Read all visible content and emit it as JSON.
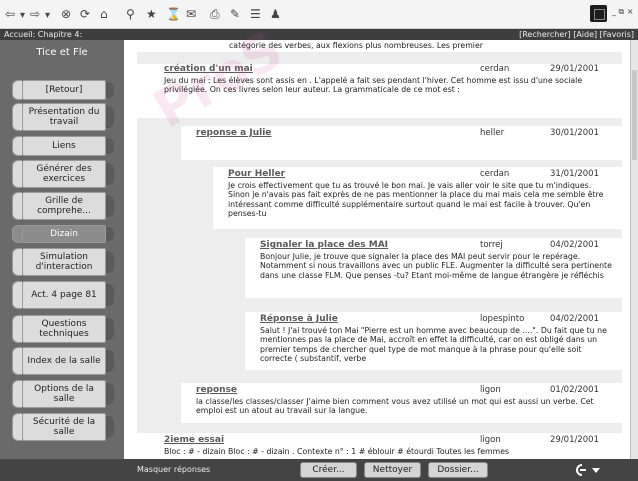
{
  "toolbar": {
    "back": "⇦",
    "forward": "⇨",
    "stop": "⊗",
    "refresh": "⟳",
    "home": "⌂",
    "search": "⚲",
    "favorites": "★",
    "history": "⌛",
    "mail": "✉",
    "print": "⎙",
    "edit": "✎",
    "discuss": "☰",
    "messenger": "♟",
    "window_controls": "_ ⧉ ×"
  },
  "header": {
    "breadcrumb": "Accueil: Chapitre 4:",
    "links": "[Rechercher] [Aide] [Favoris]"
  },
  "sidebar": {
    "title": "Tice et Fle",
    "items": [
      {
        "label": "[Retour]"
      },
      {
        "label": "Présentation du travail"
      },
      {
        "label": "Liens"
      },
      {
        "label": "Générer des exercices"
      },
      {
        "label": "Grille de comprehe..."
      },
      {
        "label": "Dizain"
      },
      {
        "label": "Simulation d'interaction"
      },
      {
        "label": "Act. 4 page 81"
      },
      {
        "label": "Questions techniques"
      },
      {
        "label": "Index de la salle"
      },
      {
        "label": "Options de la salle"
      },
      {
        "label": "Sécurité de la salle"
      }
    ]
  },
  "watermark": "ProS",
  "messages": [
    {
      "title": "",
      "author": "",
      "date": "",
      "body": "catégorie des verbes, aux flexions plus nombreuses. Les premier"
    },
    {
      "title": "création d'un mai",
      "author": "cerdan",
      "date": "29/01/2001",
      "body": "Jeu du mai : Les élèves sont assis en . L'appelé a fait ses pendant l'hiver. Cet homme est issu d'une sociale privilégiée. On ces livres selon leur auteur. La grammaticale de ce mot est :"
    },
    {
      "title": "reponse a Julie",
      "author": "heller",
      "date": "30/01/2001",
      "body": ""
    },
    {
      "title": "Pour Heller",
      "author": "cerdan",
      "date": "31/01/2001",
      "body": "Je crois effectivement que tu as trouvé le bon mai. Je vais aller voir le site que tu m'indiques. Sinon je n'avais pas fait exprès de ne pas mentionner la place du mai mais cela me semble être intéressant comme difficulté supplémentaire surtout quand le mai est facile à trouver. Qu'en penses-tu"
    },
    {
      "title": "Signaler la place des MAI",
      "author": "torrej",
      "date": "04/02/2001",
      "body": "Bonjour Julie, je trouve que signaler la place des MAI peut servir pour le repérage. Notamment si nous travaillons avec un public FLE. Augmenter la difficulté sera pertinente dans une classe FLM. Que penses -tu? Etant moi-même de langue étrangère je réfléchis"
    },
    {
      "title": "Réponse à Julie",
      "author": "lopespinto",
      "date": "04/02/2001",
      "body": "Salut ! J'ai trouvé ton Mai \"Pierre est un homme avec beaucoup de ....\". Du fait que tu ne mentionnes pas la place de Mai, accroît en effet la difficulté, car on est obligé dans un premier temps de chercher quel type de mot manque à la phrase pour qu'elle soit correcte ( substantif, verbe"
    },
    {
      "title": "reponse",
      "author": "ligon",
      "date": "01/02/2001",
      "body": "la classe/les classes/classer J'aime bien comment vous avez utilisé un mot qui est aussi un verbe. Cet emploi est un atout au travail sur la langue."
    },
    {
      "title": "2ieme essai",
      "author": "ligon",
      "date": "29/01/2001",
      "body": "Bloc : # - dizain Bloc : # - dizain . Contexte n° : 1 # éblouir # étourdi Toutes les femmes"
    }
  ],
  "bottom": {
    "hide_replies": "Masquer réponses",
    "create": "Créer...",
    "clean": "Nettoyer",
    "folder": "Dossier..."
  }
}
